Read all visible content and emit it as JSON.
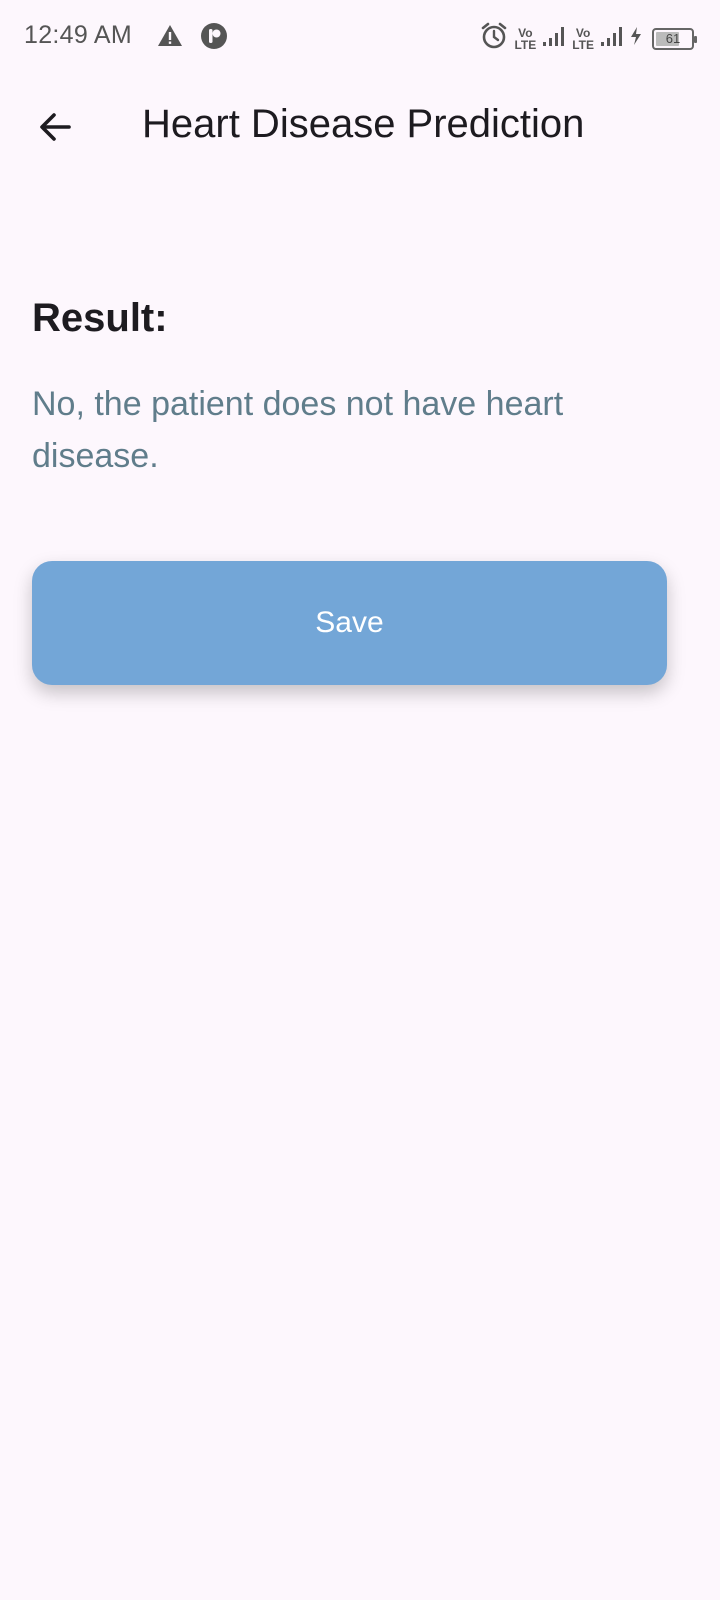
{
  "status_bar": {
    "time": "12:49 AM",
    "left_icons": [
      "warning-icon",
      "app-notification-icon"
    ],
    "right_icons": [
      "alarm-icon",
      "volte-icon",
      "signal-icon",
      "volte-icon",
      "signal-icon",
      "charging-icon"
    ],
    "volte_top": "Vo",
    "volte_bottom": "LTE",
    "battery_level": "61"
  },
  "app_bar": {
    "back_icon": "arrow-back-icon",
    "title": "Heart Disease Prediction"
  },
  "content": {
    "result_label": "Result:",
    "result_text": "No, the patient does not have heart disease.",
    "save_label": "Save"
  },
  "colors": {
    "background": "#fdf7fd",
    "button": "#73a6d7",
    "result_text": "#607d8b",
    "title": "#1d1b20"
  }
}
